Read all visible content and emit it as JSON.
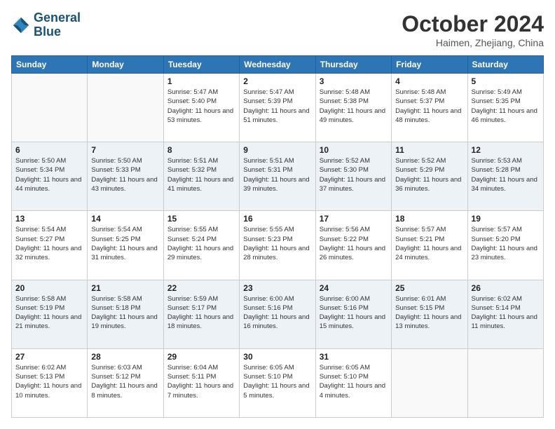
{
  "header": {
    "logo_line1": "General",
    "logo_line2": "Blue",
    "month": "October 2024",
    "location": "Haimen, Zhejiang, China"
  },
  "weekdays": [
    "Sunday",
    "Monday",
    "Tuesday",
    "Wednesday",
    "Thursday",
    "Friday",
    "Saturday"
  ],
  "weeks": [
    [
      {
        "day": "",
        "sunrise": "",
        "sunset": "",
        "daylight": ""
      },
      {
        "day": "",
        "sunrise": "",
        "sunset": "",
        "daylight": ""
      },
      {
        "day": "1",
        "sunrise": "Sunrise: 5:47 AM",
        "sunset": "Sunset: 5:40 PM",
        "daylight": "Daylight: 11 hours and 53 minutes."
      },
      {
        "day": "2",
        "sunrise": "Sunrise: 5:47 AM",
        "sunset": "Sunset: 5:39 PM",
        "daylight": "Daylight: 11 hours and 51 minutes."
      },
      {
        "day": "3",
        "sunrise": "Sunrise: 5:48 AM",
        "sunset": "Sunset: 5:38 PM",
        "daylight": "Daylight: 11 hours and 49 minutes."
      },
      {
        "day": "4",
        "sunrise": "Sunrise: 5:48 AM",
        "sunset": "Sunset: 5:37 PM",
        "daylight": "Daylight: 11 hours and 48 minutes."
      },
      {
        "day": "5",
        "sunrise": "Sunrise: 5:49 AM",
        "sunset": "Sunset: 5:35 PM",
        "daylight": "Daylight: 11 hours and 46 minutes."
      }
    ],
    [
      {
        "day": "6",
        "sunrise": "Sunrise: 5:50 AM",
        "sunset": "Sunset: 5:34 PM",
        "daylight": "Daylight: 11 hours and 44 minutes."
      },
      {
        "day": "7",
        "sunrise": "Sunrise: 5:50 AM",
        "sunset": "Sunset: 5:33 PM",
        "daylight": "Daylight: 11 hours and 43 minutes."
      },
      {
        "day": "8",
        "sunrise": "Sunrise: 5:51 AM",
        "sunset": "Sunset: 5:32 PM",
        "daylight": "Daylight: 11 hours and 41 minutes."
      },
      {
        "day": "9",
        "sunrise": "Sunrise: 5:51 AM",
        "sunset": "Sunset: 5:31 PM",
        "daylight": "Daylight: 11 hours and 39 minutes."
      },
      {
        "day": "10",
        "sunrise": "Sunrise: 5:52 AM",
        "sunset": "Sunset: 5:30 PM",
        "daylight": "Daylight: 11 hours and 37 minutes."
      },
      {
        "day": "11",
        "sunrise": "Sunrise: 5:52 AM",
        "sunset": "Sunset: 5:29 PM",
        "daylight": "Daylight: 11 hours and 36 minutes."
      },
      {
        "day": "12",
        "sunrise": "Sunrise: 5:53 AM",
        "sunset": "Sunset: 5:28 PM",
        "daylight": "Daylight: 11 hours and 34 minutes."
      }
    ],
    [
      {
        "day": "13",
        "sunrise": "Sunrise: 5:54 AM",
        "sunset": "Sunset: 5:27 PM",
        "daylight": "Daylight: 11 hours and 32 minutes."
      },
      {
        "day": "14",
        "sunrise": "Sunrise: 5:54 AM",
        "sunset": "Sunset: 5:25 PM",
        "daylight": "Daylight: 11 hours and 31 minutes."
      },
      {
        "day": "15",
        "sunrise": "Sunrise: 5:55 AM",
        "sunset": "Sunset: 5:24 PM",
        "daylight": "Daylight: 11 hours and 29 minutes."
      },
      {
        "day": "16",
        "sunrise": "Sunrise: 5:55 AM",
        "sunset": "Sunset: 5:23 PM",
        "daylight": "Daylight: 11 hours and 28 minutes."
      },
      {
        "day": "17",
        "sunrise": "Sunrise: 5:56 AM",
        "sunset": "Sunset: 5:22 PM",
        "daylight": "Daylight: 11 hours and 26 minutes."
      },
      {
        "day": "18",
        "sunrise": "Sunrise: 5:57 AM",
        "sunset": "Sunset: 5:21 PM",
        "daylight": "Daylight: 11 hours and 24 minutes."
      },
      {
        "day": "19",
        "sunrise": "Sunrise: 5:57 AM",
        "sunset": "Sunset: 5:20 PM",
        "daylight": "Daylight: 11 hours and 23 minutes."
      }
    ],
    [
      {
        "day": "20",
        "sunrise": "Sunrise: 5:58 AM",
        "sunset": "Sunset: 5:19 PM",
        "daylight": "Daylight: 11 hours and 21 minutes."
      },
      {
        "day": "21",
        "sunrise": "Sunrise: 5:58 AM",
        "sunset": "Sunset: 5:18 PM",
        "daylight": "Daylight: 11 hours and 19 minutes."
      },
      {
        "day": "22",
        "sunrise": "Sunrise: 5:59 AM",
        "sunset": "Sunset: 5:17 PM",
        "daylight": "Daylight: 11 hours and 18 minutes."
      },
      {
        "day": "23",
        "sunrise": "Sunrise: 6:00 AM",
        "sunset": "Sunset: 5:16 PM",
        "daylight": "Daylight: 11 hours and 16 minutes."
      },
      {
        "day": "24",
        "sunrise": "Sunrise: 6:00 AM",
        "sunset": "Sunset: 5:16 PM",
        "daylight": "Daylight: 11 hours and 15 minutes."
      },
      {
        "day": "25",
        "sunrise": "Sunrise: 6:01 AM",
        "sunset": "Sunset: 5:15 PM",
        "daylight": "Daylight: 11 hours and 13 minutes."
      },
      {
        "day": "26",
        "sunrise": "Sunrise: 6:02 AM",
        "sunset": "Sunset: 5:14 PM",
        "daylight": "Daylight: 11 hours and 11 minutes."
      }
    ],
    [
      {
        "day": "27",
        "sunrise": "Sunrise: 6:02 AM",
        "sunset": "Sunset: 5:13 PM",
        "daylight": "Daylight: 11 hours and 10 minutes."
      },
      {
        "day": "28",
        "sunrise": "Sunrise: 6:03 AM",
        "sunset": "Sunset: 5:12 PM",
        "daylight": "Daylight: 11 hours and 8 minutes."
      },
      {
        "day": "29",
        "sunrise": "Sunrise: 6:04 AM",
        "sunset": "Sunset: 5:11 PM",
        "daylight": "Daylight: 11 hours and 7 minutes."
      },
      {
        "day": "30",
        "sunrise": "Sunrise: 6:05 AM",
        "sunset": "Sunset: 5:10 PM",
        "daylight": "Daylight: 11 hours and 5 minutes."
      },
      {
        "day": "31",
        "sunrise": "Sunrise: 6:05 AM",
        "sunset": "Sunset: 5:10 PM",
        "daylight": "Daylight: 11 hours and 4 minutes."
      },
      {
        "day": "",
        "sunrise": "",
        "sunset": "",
        "daylight": ""
      },
      {
        "day": "",
        "sunrise": "",
        "sunset": "",
        "daylight": ""
      }
    ]
  ]
}
